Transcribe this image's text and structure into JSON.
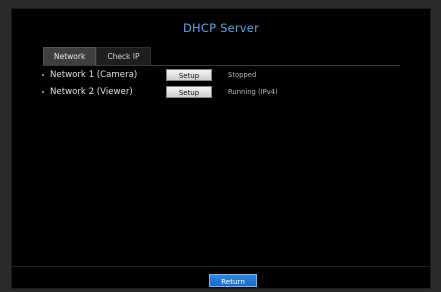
{
  "window": {
    "title": "DHCP Server"
  },
  "tabs": [
    {
      "label": "Network",
      "active": true
    },
    {
      "label": "Check IP",
      "active": false
    }
  ],
  "networks": [
    {
      "label": "Network 1 (Camera)",
      "button": "Setup",
      "status": "Stopped"
    },
    {
      "label": "Network 2 (Viewer)",
      "button": "Setup",
      "status": "Running (IPv4)"
    }
  ],
  "footer": {
    "return_label": "Return"
  },
  "colors": {
    "title": "#5fa3e6",
    "return_button": "#2f86e0",
    "background": "#000000"
  }
}
